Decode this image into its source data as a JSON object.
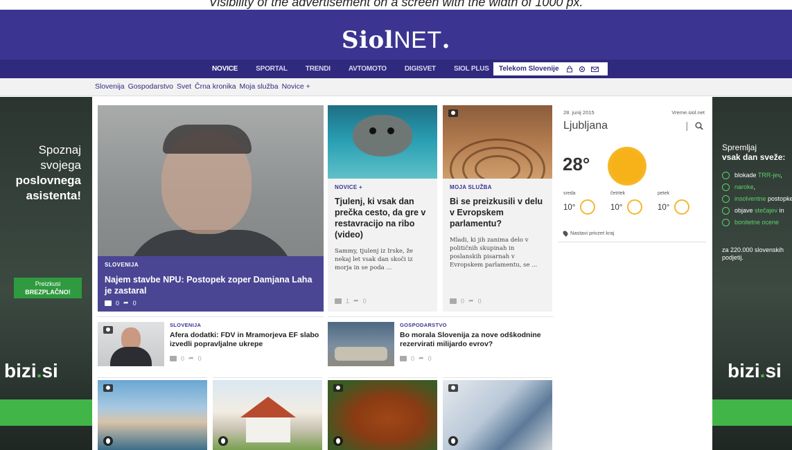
{
  "caption": "Visibility of the advertisement on a screen with the width of 1000 px.",
  "brand": {
    "bold": "Siol",
    "light": "NET",
    "dot": "."
  },
  "nav": {
    "items": [
      "NOVICE",
      "SPORTAL",
      "TRENDI",
      "AVTOMOTO",
      "DIGISVET",
      "SIOL PLUS"
    ],
    "telekom_label": "Telekom Slovenije",
    "icons": [
      "lock-icon",
      "gear-icon",
      "mail-icon"
    ]
  },
  "subnav": [
    "Slovenija",
    "Gospodarstvo",
    "Svet",
    "Črna kronika",
    "Moja služba",
    "Novice +"
  ],
  "left_ad": {
    "line1": "Spoznaj",
    "line2": "svojega",
    "line3": "poslovnega",
    "line4": "asistenta!",
    "cta_line1": "Preizkusi",
    "cta_line2": "BREZPLAČNO!",
    "brand_main": "bizi",
    "brand_dot": ".",
    "brand_tld": "si"
  },
  "right_ad": {
    "heading1": "Spremljaj",
    "heading2": "vsak dan sveže:",
    "items": [
      {
        "prefix": "",
        "hl": "blokade ",
        "link": "TRR-jev",
        "suffix": ","
      },
      {
        "prefix": "",
        "hl": "",
        "link": "naroke",
        "suffix": ","
      },
      {
        "prefix": "",
        "hl": "",
        "link": "insolventne",
        "suffix": " postopke,"
      },
      {
        "prefix": "objave ",
        "hl": "",
        "link": "stečajev",
        "suffix": " in"
      },
      {
        "prefix": "",
        "hl": "",
        "link": "bonitetne ocene",
        "suffix": ""
      }
    ],
    "footer": "za 220.000 slovenskih podjetij.",
    "brand_main": "bizi",
    "brand_dot": ".",
    "brand_tld": "si"
  },
  "main_story": {
    "category": "SLOVENIJA",
    "title": "Najem stavbe NPU: Postopek zoper Damjana Laha je zastaral",
    "comments": "0",
    "shares": "0"
  },
  "card1": {
    "category": "NOVICE +",
    "title": "Tjulenj, ki vsak dan prečka cesto, da gre v restavracijo na ribo (video)",
    "description": "Sammy, tjulenj iz Irske, že nekaj let vsak dan skoči iz morja in se poda ...",
    "comments": "1",
    "shares": "0"
  },
  "card2": {
    "category": "MOJA SLUŽBA",
    "title": "Bi se preizkusili v delu v Evropskem parlamentu?",
    "description": "Mladi, ki jih zanima delo v političnih skupinah in poslanskih pisarnah v Evropskem parlamentu, se ...",
    "comments": "0",
    "shares": "0"
  },
  "weather": {
    "date": "28. junij 2015",
    "source": "Vreme.siol.net",
    "city": "Ljubljana",
    "temperature": "28°",
    "days": [
      {
        "name": "sreda",
        "temp": "10°"
      },
      {
        "name": "četrtek",
        "temp": "10°"
      },
      {
        "name": "petek",
        "temp": "10°"
      }
    ],
    "location_label": "Nastavi privzet kraj"
  },
  "row2": [
    {
      "category": "SLOVENIJA",
      "title": "Afera dodatki: FDV in Mramorjeva EF slabo izvedli popravljalne ukrepe",
      "comments": "0",
      "shares": "0"
    },
    {
      "category": "GOSPODARSTVO",
      "title": "Bo morala Slovenija za nove odškodnine rezervirati milijardo evrov?",
      "comments": "0",
      "shares": "0"
    }
  ],
  "colors": {
    "brand_purple": "#3b3591",
    "nav_purple": "#2f2a7e",
    "ad_green": "#42b549",
    "sun": "#f7b21a"
  }
}
